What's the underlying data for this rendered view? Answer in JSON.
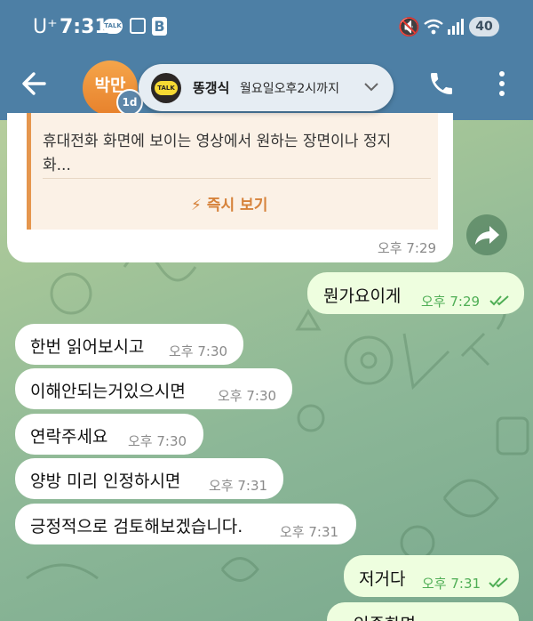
{
  "status_bar": {
    "carrier": "U⁺",
    "time": "7:31",
    "talk_badge": "TALK",
    "b_badge": "B",
    "battery": "40",
    "icons": [
      "kakaotalk-icon",
      "scan-icon",
      "b-app-icon",
      "mute-icon",
      "wifi-icon",
      "signal-icon",
      "battery-icon"
    ]
  },
  "header": {
    "back_icon": "arrow-left-icon",
    "avatar_initials": "박만",
    "story_badge": "1d",
    "call_icon": "phone-icon",
    "menu_icon": "more-vertical-icon"
  },
  "notification": {
    "icon_label": "TALK",
    "sender": "똥갱식",
    "text": "월요일오후2시까지",
    "chevron_icon": "chevron-down-icon"
  },
  "messages": [
    {
      "type": "link_preview",
      "direction": "in",
      "line1": "휴대전화 화면에 보이는 영상에서 원하는 장면이나 정지",
      "line2": "화...",
      "instant_view": "즉시 보기",
      "time": "오후 7:29"
    },
    {
      "direction": "out",
      "text": "뭔가요이게",
      "time": "오후 7:29",
      "read": true
    },
    {
      "direction": "in",
      "text": "한번 읽어보시고",
      "time": "오후 7:30"
    },
    {
      "direction": "in",
      "text": "이해안되는거있으시면",
      "time": "오후 7:30"
    },
    {
      "direction": "in",
      "text": "연락주세요",
      "time": "오후 7:30"
    },
    {
      "direction": "in",
      "text": "양방 미리 인정하시면",
      "time": "오후 7:31"
    },
    {
      "direction": "in",
      "text": "긍정적으로 검토해보겠습니다.",
      "time": "오후 7:31"
    },
    {
      "direction": "out",
      "text": "저거다",
      "time": "오후 7:31",
      "read": true
    },
    {
      "direction": "out",
      "text": "인증화면",
      "time": ""
    }
  ],
  "colors": {
    "header": "#4d7fa5",
    "incoming_bubble": "#ffffff",
    "outgoing_bubble": "#eefedf",
    "outgoing_time": "#4fae55",
    "instant_view_accent": "#d6823a",
    "avatar": "#e7812c"
  }
}
